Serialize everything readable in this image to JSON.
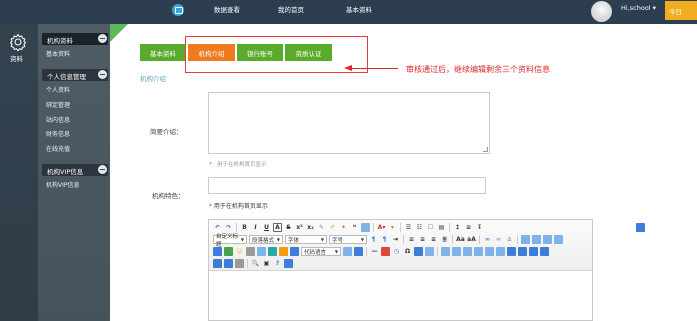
{
  "topbar": {
    "nav": [
      "数据查看",
      "我的首页",
      "基本资料"
    ],
    "greeting": "Hi,school ▾",
    "today": "今日"
  },
  "iconcol": {
    "label": "资料",
    "icon": "gear-icon"
  },
  "sidebar": {
    "sections": [
      {
        "label": "机构资料",
        "items": [
          "基本资料"
        ]
      },
      {
        "label": "个人信息管理",
        "items": [
          "个人资料",
          "绑定管理",
          "站内信息",
          "财务信息",
          "在线充值"
        ]
      },
      {
        "label": "机构VIP信息",
        "items": [
          "机构VIP信息"
        ]
      }
    ]
  },
  "tabs": [
    "基本资料",
    "机构介绍",
    "银行账号",
    "资质认证"
  ],
  "annotation": "审核通过后，继续编辑剩余三个资料信息",
  "form": {
    "section_title": "机构介绍",
    "intro_label": "简要介绍：",
    "intro_hint": "用于在机构首页显示",
    "feature_label": "机构特色：",
    "feature_hint": "用于在机构首页显示",
    "star": "*"
  },
  "editor": {
    "selects": [
      "自定义标题",
      "段落格式",
      "字体",
      "字号",
      "代码语言"
    ]
  },
  "colors": {
    "topbar": "#2d3e50",
    "tab_green": "#5aab2c",
    "tab_orange": "#f07a1e",
    "annotation_red": "#d9282a",
    "section_title": "#5da3c4"
  }
}
